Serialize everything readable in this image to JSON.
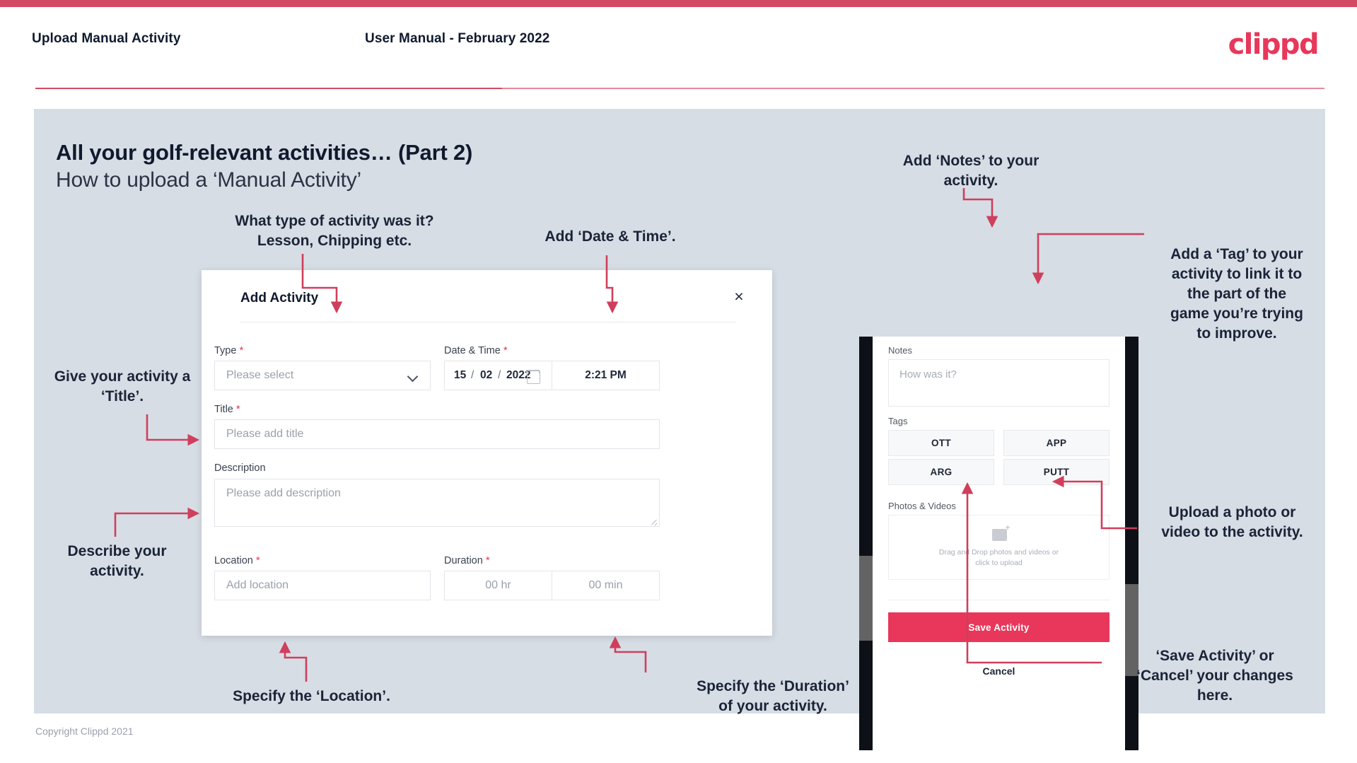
{
  "header": {
    "title": "Upload Manual Activity",
    "subtitle": "User Manual - February 2022",
    "logo": "clippd"
  },
  "slide": {
    "heading": "All your golf-relevant activities… (Part 2)",
    "subheading": "How to upload a ‘Manual Activity’"
  },
  "dialog": {
    "title": "Add Activity",
    "close_icon": "×",
    "fields": {
      "type": {
        "label": "Type",
        "required": "*",
        "placeholder": "Please select"
      },
      "datetime": {
        "label": "Date & Time",
        "required": "*",
        "day": "15",
        "sep1": "/",
        "month": "02",
        "sep2": "/",
        "year": "2022",
        "time": "2:21 PM"
      },
      "title": {
        "label": "Title",
        "required": "*",
        "placeholder": "Please add title"
      },
      "description": {
        "label": "Description",
        "placeholder": "Please add description"
      },
      "location": {
        "label": "Location",
        "required": "*",
        "placeholder": "Add location"
      },
      "duration": {
        "label": "Duration",
        "required": "*",
        "hours": "00 hr",
        "minutes": "00 min"
      }
    }
  },
  "phone": {
    "notes": {
      "label": "Notes",
      "placeholder": "How was it?"
    },
    "tags": {
      "label": "Tags",
      "items": [
        "OTT",
        "APP",
        "ARG",
        "PUTT"
      ]
    },
    "media": {
      "label": "Photos & Videos",
      "drop_line1": "Drag and Drop photos and videos or",
      "drop_line2": "click to upload"
    },
    "save_label": "Save Activity",
    "cancel_label": "Cancel"
  },
  "annotations": {
    "type": "What type of activity was it?\nLesson, Chipping etc.",
    "datetime": "Add ‘Date & Time’.",
    "title": "Give your activity a\n‘Title’.",
    "description": "Describe your\nactivity.",
    "location": "Specify the ‘Location’.",
    "duration": "Specify the ‘Duration’\nof your activity.",
    "notes": "Add ‘Notes’ to your\nactivity.",
    "tags": "Add a ‘Tag’ to your\nactivity to link it to\nthe part of the\ngame you’re trying\nto improve.",
    "media": "Upload a photo or\nvideo to the activity.",
    "save": "‘Save Activity’ or\n‘Cancel’ your changes\nhere."
  },
  "footer": "Copyright Clippd 2021",
  "colors": {
    "accent": "#e8375a",
    "bar": "#d34b62",
    "stage": "#d7dde5",
    "ink": "#1b2437"
  }
}
